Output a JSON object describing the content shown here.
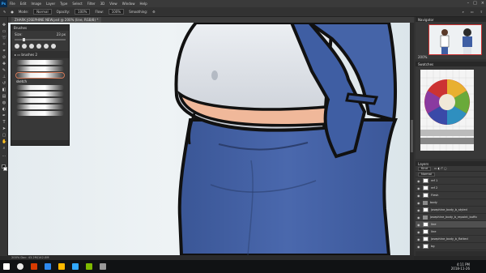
{
  "menubar": {
    "app_logo": "Ps",
    "items": [
      "File",
      "Edit",
      "Image",
      "Layer",
      "Type",
      "Select",
      "Filter",
      "3D",
      "View",
      "Window",
      "Help"
    ]
  },
  "options": {
    "mode_label": "Mode:",
    "mode_value": "Normal",
    "opacity_label": "Opacity:",
    "opacity_value": "100%",
    "flow_label": "Flow:",
    "flow_value": "100%",
    "smoothing_label": "Smoothing:"
  },
  "document": {
    "tab_title": "ZHARK JOSEPHINE NEW.psd @ 200% (line, RGB/8) *"
  },
  "brushes_panel": {
    "title": "Brushes",
    "size_label": "Size:",
    "size_value": "23 px",
    "group_name": "brushes 2",
    "selected_brush_label": "sketch"
  },
  "navigator": {
    "title": "Navigator",
    "zoom": "200%"
  },
  "swatches": {
    "title": "Swatches"
  },
  "layers": {
    "title": "Layers",
    "kind_label": "Kind",
    "blend_mode": "Normal",
    "rows": [
      {
        "name": "ref 1",
        "type": "layer"
      },
      {
        "name": "ref 2",
        "type": "layer"
      },
      {
        "name": "Flesh",
        "type": "layer"
      },
      {
        "name": "body",
        "type": "folder"
      },
      {
        "name": "josephine_body_b_styled",
        "type": "layer"
      },
      {
        "name": "josephine_body_b_repaint_buffo",
        "type": "folder"
      },
      {
        "name": "line",
        "type": "layer"
      },
      {
        "name": "line",
        "type": "layer"
      },
      {
        "name": "josephine_body_b_flatted",
        "type": "layer"
      },
      {
        "name": "bg",
        "type": "layer"
      }
    ]
  },
  "statusbar": {
    "text": "200%    Doc: 43.2M/142.0M"
  },
  "taskbar": {
    "time": "4:11 PM",
    "date": "2018-11-26",
    "colors": [
      "#ffffff",
      "#e8e8e8",
      "#d83b01",
      "#2d89ef",
      "#ffb900",
      "#31a8ff",
      "#7fba00",
      "#9a9a9a"
    ]
  },
  "colors": {
    "shirt_blue": "#3f5ea3",
    "line_black": "#111111",
    "skin": "#f0b89a",
    "white_cloth": "#e0e4ea"
  }
}
